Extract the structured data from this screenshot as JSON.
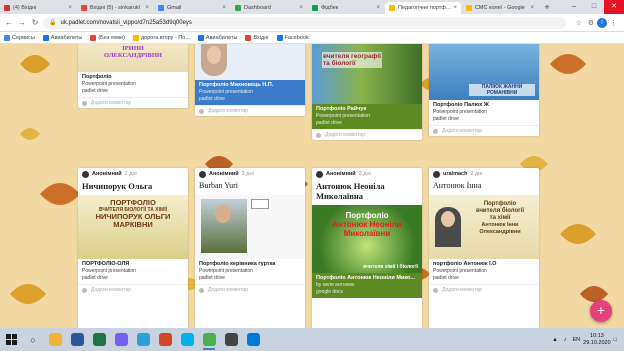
{
  "browser": {
    "tabs": [
      {
        "title": "(4) Вхідні",
        "color": "#d93025",
        "active": false
      },
      {
        "title": "Вхідні (5) - sinkarukl",
        "color": "#ea4335",
        "active": false
      },
      {
        "title": "Gmail",
        "color": "#4285f4",
        "active": false
      },
      {
        "title": "Dashboard",
        "color": "#34a853",
        "active": false
      },
      {
        "title": "Фідбек",
        "color": "#0f9d58",
        "active": false
      },
      {
        "title": "Педагогічне портфоліо",
        "color": "#fbbc04",
        "active": true
      },
      {
        "title": "СМС колеї - Google",
        "color": "#fbbc04",
        "active": false
      }
    ],
    "new_tab": "+",
    "url": "uk.padlet.com/novatsii_vippo/d7n25a53d9q00eys",
    "bookmarks": [
      {
        "label": "Сервисы",
        "color": "#4285f4"
      },
      {
        "label": "Авиабилеты",
        "color": "#1a73e8"
      },
      {
        "label": "(Без теми)",
        "color": "#ea4335"
      },
      {
        "label": "дорога вгору - По...",
        "color": "#fbbc04"
      },
      {
        "label": "Авиабилеты",
        "color": "#1a73e8"
      },
      {
        "label": "Вхідні",
        "color": "#ea4335"
      },
      {
        "label": "Facebook",
        "color": "#1877f2"
      }
    ]
  },
  "padlet": {
    "comment_placeholder": "Додати коментар",
    "top_cards": [
      {
        "thumb_text": "ІРИНИ ОЛЕКСАНДРІВНИ",
        "title": "Портфоліо",
        "subtitle": "Powerpoint presentation",
        "source": "padlet drive",
        "meta_style": "light"
      },
      {
        "thumb_text": "",
        "title": "Портфоліо Махновець Н.П.",
        "subtitle": "Powerpoint presentation",
        "source": "padlet drive",
        "meta_style": "light"
      },
      {
        "thumb_text": "вчителя географії та біології",
        "title": "Портфоліо Райчук",
        "subtitle": "Powerpoint presentation",
        "source": "padlet drive",
        "meta_style": "green"
      },
      {
        "thumb_text": "ПАЛІЮК ЖАННИ РОМАНІВНИ",
        "title": "Портфоліо Палюх Ж",
        "subtitle": "Powerpoint presentation",
        "source": "padlet drive",
        "meta_style": "light"
      }
    ],
    "bottom_cards": [
      {
        "author": "Анонімний",
        "time": "2 дні",
        "title": "Ничипорук Ольга",
        "thumb_lines": [
          "ПОРТФОЛІО",
          "ВЧИТЕЛЯ БІОЛОГІЇ ТА ХІМІЇ",
          "НИЧИПОРУК ОЛЬГИ",
          "МАРКІВНИ"
        ],
        "att_title": "ПОРТФОЛІО-ОЛЯ",
        "att_sub": "Powerpoint presentation",
        "att_src": "padlet drive"
      },
      {
        "author": "Анонімний",
        "time": "2 дні",
        "title": "Burban  Yuri",
        "thumb_lines": [],
        "att_title": "Портфоліо керівника гуртка",
        "att_sub": "Powerpoint presentation",
        "att_src": "padlet drive"
      },
      {
        "author": "Анонімний",
        "time": "2 дні",
        "title": "Антонюк Неоніла Миколаївна",
        "thumb_lines": [
          "Портфоліо",
          "Антонюк Неоніли",
          "Миколаївни",
          "вчителя хімії і біології"
        ],
        "att_title": "Портфоліо Антонюк Неоніли Мико...",
        "att_sub": "by неля антонюк",
        "att_src": "google docs"
      },
      {
        "author": "uralmach",
        "time": "2 дні",
        "title": "Антонюк Інна",
        "thumb_lines": [
          "Портфоліо",
          "вчителя біології",
          "та хімії",
          "Антонюк Інни",
          "Олександрівни"
        ],
        "att_title": "портфоліо Антонюк І.О",
        "att_sub": "Powerpoint presentation",
        "att_src": "padlet drive"
      }
    ],
    "fab_label": "+"
  },
  "taskbar": {
    "apps": [
      {
        "name": "file-explorer",
        "color": "#f2b233"
      },
      {
        "name": "word",
        "color": "#2b579a"
      },
      {
        "name": "excel",
        "color": "#217346"
      },
      {
        "name": "viber",
        "color": "#7360f2"
      },
      {
        "name": "telegram",
        "color": "#2aa1da"
      },
      {
        "name": "powerpoint",
        "color": "#d24726"
      },
      {
        "name": "skype",
        "color": "#00aff0"
      },
      {
        "name": "chrome",
        "color": "#4caf50"
      },
      {
        "name": "photos",
        "color": "#444"
      },
      {
        "name": "store",
        "color": "#0078d7"
      }
    ],
    "lang": "EN",
    "time": "10:13",
    "date": "29.10.2020"
  }
}
